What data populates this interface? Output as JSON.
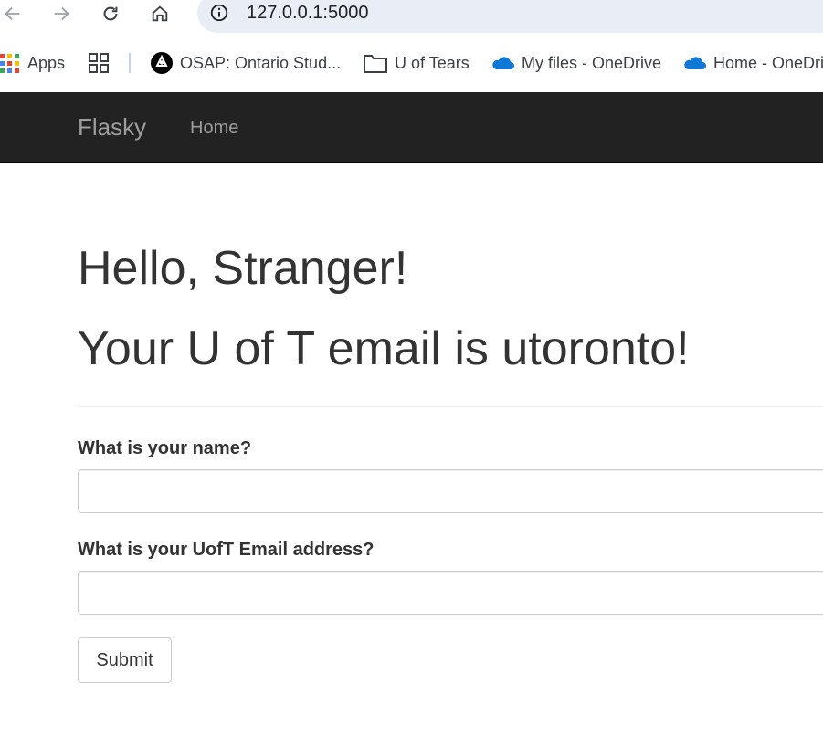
{
  "browser": {
    "url": "127.0.0.1:5000",
    "bookmarks": [
      {
        "label": "Apps",
        "icon": "apps-grid-icon"
      },
      {
        "label": "",
        "icon": "tab-groups-icon"
      },
      {
        "label": "OSAP: Ontario Stud...",
        "icon": "ontario-trillium-icon"
      },
      {
        "label": "U of Tears",
        "icon": "folder-icon"
      },
      {
        "label": "My files - OneDrive",
        "icon": "onedrive-cloud-icon"
      },
      {
        "label": "Home - OneDri",
        "icon": "onedrive-cloud-icon"
      }
    ]
  },
  "navbar": {
    "brand": "Flasky",
    "home": "Home"
  },
  "page": {
    "greeting": "Hello, Stranger!",
    "email_message": "Your U of T email is utoronto!",
    "form": {
      "name_label": "What is your name?",
      "name_value": "",
      "email_label": "What is your UofT Email address?",
      "email_value": "",
      "submit_label": "Submit"
    }
  },
  "colors": {
    "navbar_bg": "#222222",
    "navbar_text": "#9d9d9d",
    "omnibox_bg": "#e9eef6",
    "text": "#333333"
  }
}
